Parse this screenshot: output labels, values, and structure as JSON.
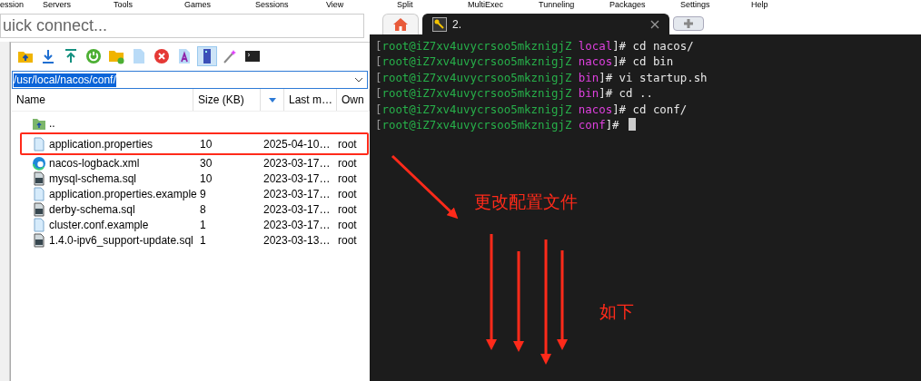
{
  "menu": [
    "ession",
    "Servers",
    "Tools",
    "Games",
    "Sessions",
    "View",
    "Split",
    "MultiExec",
    "Tunneling",
    "Packages",
    "Settings",
    "Help"
  ],
  "quick_connect": {
    "placeholder": "uick connect..."
  },
  "sftp": {
    "toolbar": [
      {
        "kind": "up-folder",
        "selected": false
      },
      {
        "kind": "download",
        "selected": false
      },
      {
        "kind": "upload",
        "selected": false
      },
      {
        "kind": "refresh",
        "selected": false
      },
      {
        "kind": "new-folder",
        "selected": false
      },
      {
        "kind": "new-file",
        "selected": false
      },
      {
        "kind": "delete",
        "selected": false
      },
      {
        "kind": "text",
        "selected": false
      },
      {
        "kind": "pane",
        "selected": true
      },
      {
        "kind": "wand",
        "selected": false
      },
      {
        "kind": "terminal",
        "selected": false
      }
    ],
    "path": "/usr/local/nacos/conf/",
    "columns": [
      "Name",
      "Size (KB)",
      "Last m…",
      "Own"
    ],
    "rows": [
      {
        "kind": "parent",
        "name": "..",
        "annotated": false
      },
      {
        "kind": "text",
        "name": "application.properties",
        "size": "10",
        "modified": "2025-04-10…",
        "owner": "root",
        "annotated": true
      },
      {
        "kind": "xml",
        "name": "nacos-logback.xml",
        "size": "30",
        "modified": "2023-03-17…",
        "owner": "root",
        "annotated": false
      },
      {
        "kind": "sql",
        "name": "mysql-schema.sql",
        "size": "10",
        "modified": "2023-03-17…",
        "owner": "root",
        "annotated": false
      },
      {
        "kind": "text",
        "name": "application.properties.example",
        "size": "9",
        "modified": "2023-03-17…",
        "owner": "root",
        "annotated": false
      },
      {
        "kind": "sql",
        "name": "derby-schema.sql",
        "size": "8",
        "modified": "2023-03-17…",
        "owner": "root",
        "annotated": false
      },
      {
        "kind": "text",
        "name": "cluster.conf.example",
        "size": "1",
        "modified": "2023-03-17…",
        "owner": "root",
        "annotated": false
      },
      {
        "kind": "sql",
        "name": "1.4.0-ipv6_support-update.sql",
        "size": "1",
        "modified": "2023-03-13…",
        "owner": "root",
        "annotated": false
      }
    ]
  },
  "tabs": [
    {
      "kind": "home",
      "selected": false
    },
    {
      "kind": "session",
      "label": "2.",
      "selected": true
    },
    {
      "kind": "new",
      "selected": false
    }
  ],
  "terminal": {
    "lines": [
      {
        "open": "[",
        "user": "root@iZ7xv4uvycrsoo5mkznigjZ",
        "dir": "local",
        "close": "]#",
        "command": "cd nacos/",
        "cursor": false
      },
      {
        "open": "[",
        "user": "root@iZ7xv4uvycrsoo5mkznigjZ",
        "dir": "nacos",
        "close": "]#",
        "command": "cd bin",
        "cursor": false
      },
      {
        "open": "[",
        "user": "root@iZ7xv4uvycrsoo5mkznigjZ",
        "dir": "bin",
        "close": "]#",
        "command": "vi startup.sh",
        "cursor": false
      },
      {
        "open": "[",
        "user": "root@iZ7xv4uvycrsoo5mkznigjZ",
        "dir": "bin",
        "close": "]#",
        "command": "cd ..",
        "cursor": false
      },
      {
        "open": "[",
        "user": "root@iZ7xv4uvycrsoo5mkznigjZ",
        "dir": "nacos",
        "close": "]#",
        "command": "cd conf/",
        "cursor": false
      },
      {
        "open": "[",
        "user": "root@iZ7xv4uvycrsoo5mkznigjZ",
        "dir": "conf",
        "close": "]#",
        "cursor": true
      }
    ]
  },
  "annotations": [
    {
      "text": "更改配置文件"
    },
    {
      "text": "如下"
    }
  ]
}
